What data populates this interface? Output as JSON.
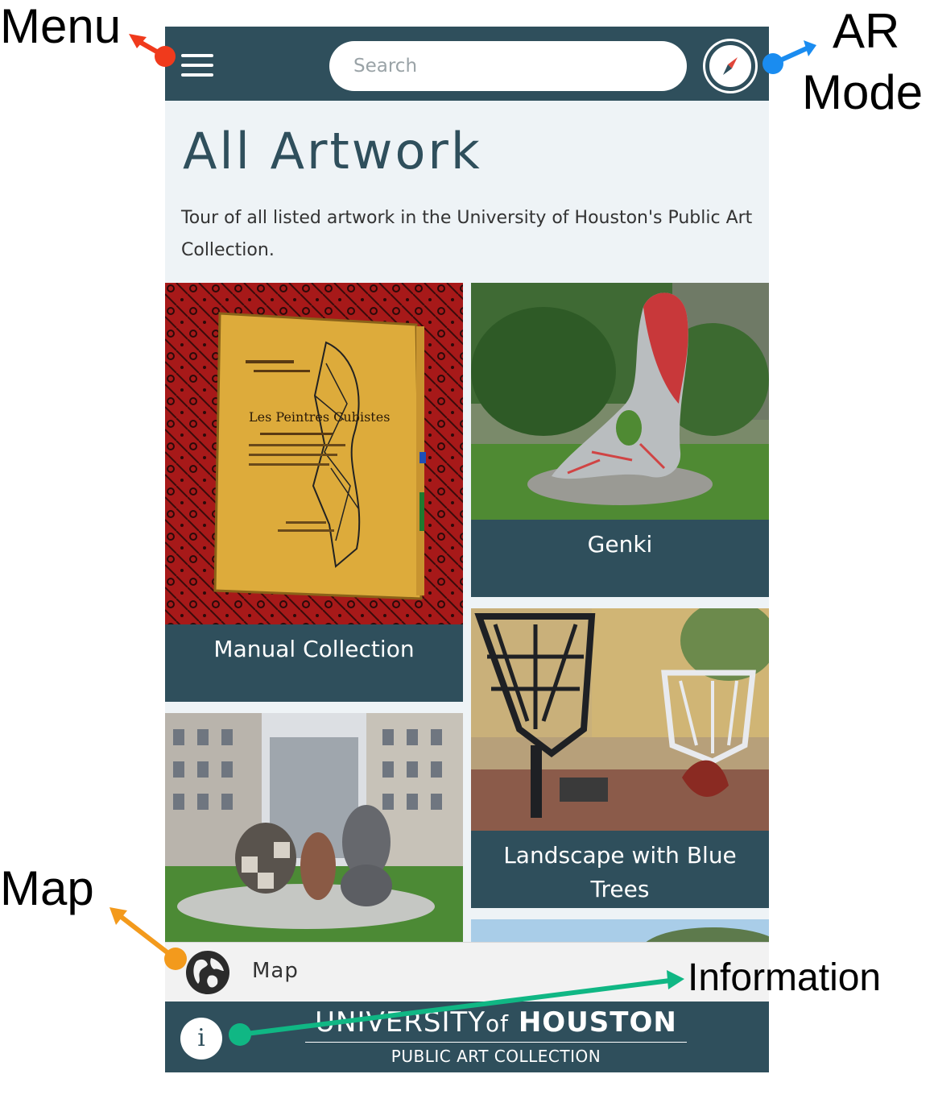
{
  "header": {
    "menu_icon": "hamburger-menu-icon",
    "search_placeholder": "Search",
    "ar_icon": "compass-icon"
  },
  "page": {
    "title": "All Artwork",
    "description": "Tour of all listed artwork in the University of Houston's Public Art Collection."
  },
  "artworks": [
    {
      "title": "Manual Collection"
    },
    {
      "title": "Genki"
    },
    {
      "title": ""
    },
    {
      "title": "Landscape with Blue Trees"
    }
  ],
  "map_bar": {
    "icon": "globe-icon",
    "label": "Map"
  },
  "footer": {
    "info_glyph": "i",
    "brand_prefix": "UNIVERSITY",
    "brand_of": "of",
    "brand_name": "HOUSTON",
    "brand_sub": "PUBLIC ART COLLECTION"
  },
  "annotations": {
    "menu": "Menu",
    "ar_line1": "AR",
    "ar_line2": "Mode",
    "map": "Map",
    "information": "Information"
  },
  "colors": {
    "primary": "#2f4f5c",
    "background": "#eef3f6",
    "menu_arrow": "#f03a1c",
    "ar_arrow": "#1a8cf0",
    "map_arrow": "#f39a1c",
    "info_arrow": "#10b784"
  }
}
